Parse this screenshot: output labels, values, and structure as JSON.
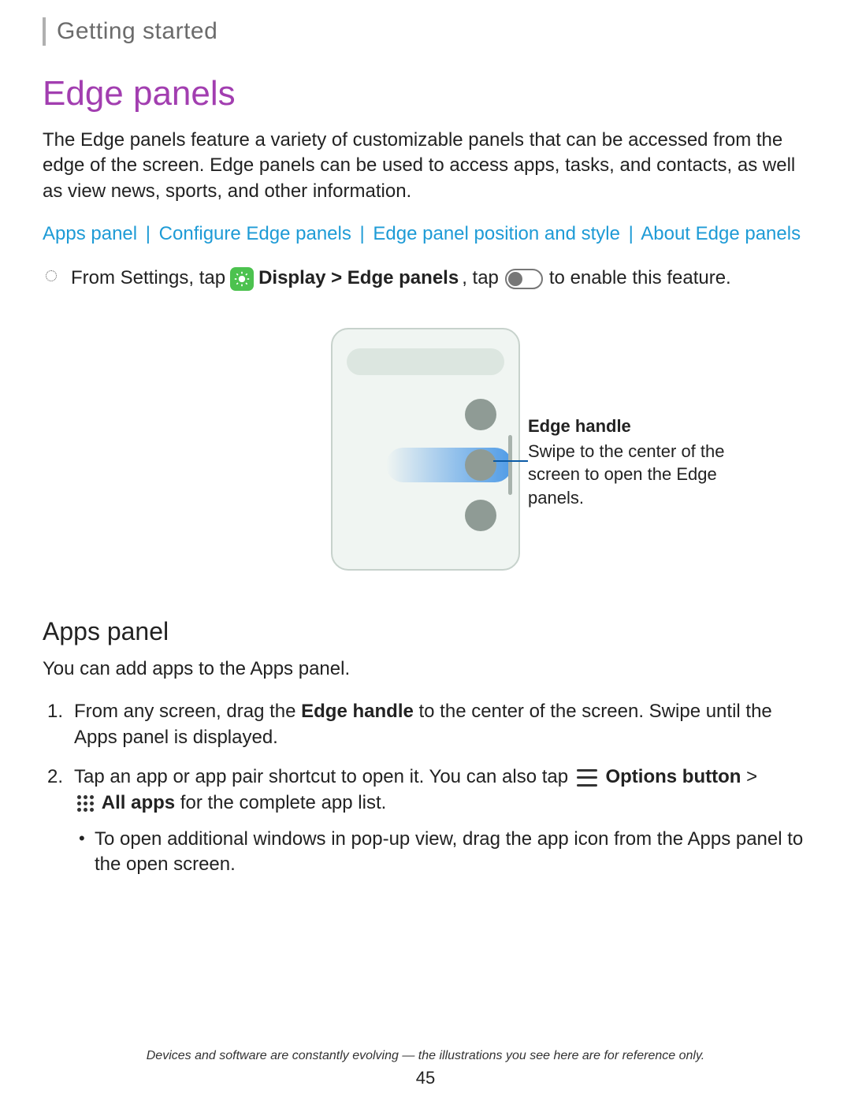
{
  "breadcrumb": "Getting started",
  "h1": "Edge panels",
  "intro": "The Edge panels feature a variety of customizable panels that can be accessed from the edge of the screen. Edge panels can be used to access apps, tasks, and contacts, as well as view news, sports, and other information.",
  "links": {
    "apps_panel": "Apps panel",
    "configure": "Configure Edge panels",
    "position": "Edge panel position and style",
    "about": "About Edge panels",
    "sep": "|"
  },
  "instr": {
    "part1": "From Settings, tap",
    "display_bold": " Display > Edge panels",
    "part2": ", tap",
    "part3": "to enable this feature."
  },
  "callout": {
    "title": "Edge handle",
    "body": "Swipe to the center of the screen to open the Edge panels."
  },
  "h2": "Apps panel",
  "apps_intro": "You can add apps to the Apps panel.",
  "step1": {
    "a": "From any screen, drag the ",
    "b": "Edge handle",
    "c": " to the center of the screen. Swipe until the Apps panel is displayed."
  },
  "step2": {
    "a": "Tap an app or app pair shortcut to open it. You can also tap",
    "options": " Options button",
    "gt": " >",
    "allapps": " All apps",
    "b": " for the complete app list."
  },
  "sub1": "To open additional windows in pop-up view, drag the app icon from the Apps panel to the open screen.",
  "footer": "Devices and software are constantly evolving — the illustrations you see here are for reference only.",
  "page": "45"
}
